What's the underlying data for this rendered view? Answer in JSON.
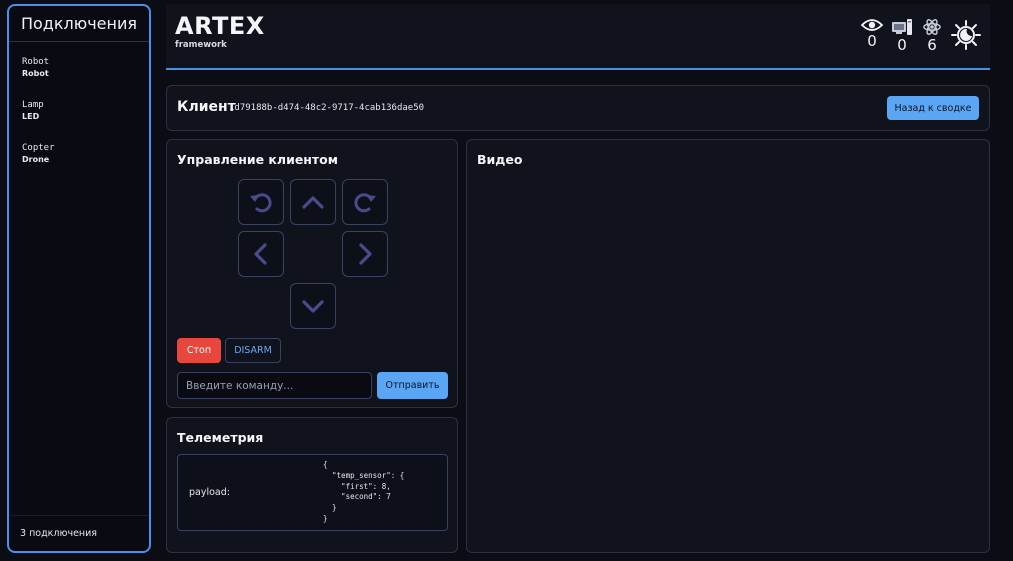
{
  "sidebar": {
    "title": "Подключения",
    "connections": [
      {
        "name": "Robot",
        "type": "Robot"
      },
      {
        "name": "Lamp",
        "type": "LED"
      },
      {
        "name": "Copter",
        "type": "Drone"
      }
    ],
    "footer": "3 подключения"
  },
  "header": {
    "logo_title": "ARTEX",
    "logo_subtitle": "framework",
    "stats": [
      {
        "icon": "eye-icon",
        "value": "0"
      },
      {
        "icon": "devices-icon",
        "value": "0"
      },
      {
        "icon": "atom-icon",
        "value": "6"
      }
    ],
    "theme_icon": "sun-moon-icon"
  },
  "client": {
    "label": "Клиент",
    "id": "1d79188b-d474-48c2-9717-4cab136dae50",
    "back_label": "Назад к сводке"
  },
  "control": {
    "title": "Управление клиентом",
    "stop_label": "Стоп",
    "disarm_label": "DISARM",
    "command_placeholder": "Введите команду...",
    "send_label": "Отправить"
  },
  "telemetry": {
    "title": "Телеметрия",
    "key": "payload:",
    "json_text": "{\n  \"temp_sensor\": {\n    \"first\": 8,\n    \"second\": 7\n  }\n}"
  },
  "video": {
    "title": "Видео"
  },
  "colors": {
    "accent": "#4a8fe8",
    "button_primary": "#5aa6f5",
    "stop": "#e8473d",
    "pad_icon": "#4a4a8c"
  }
}
